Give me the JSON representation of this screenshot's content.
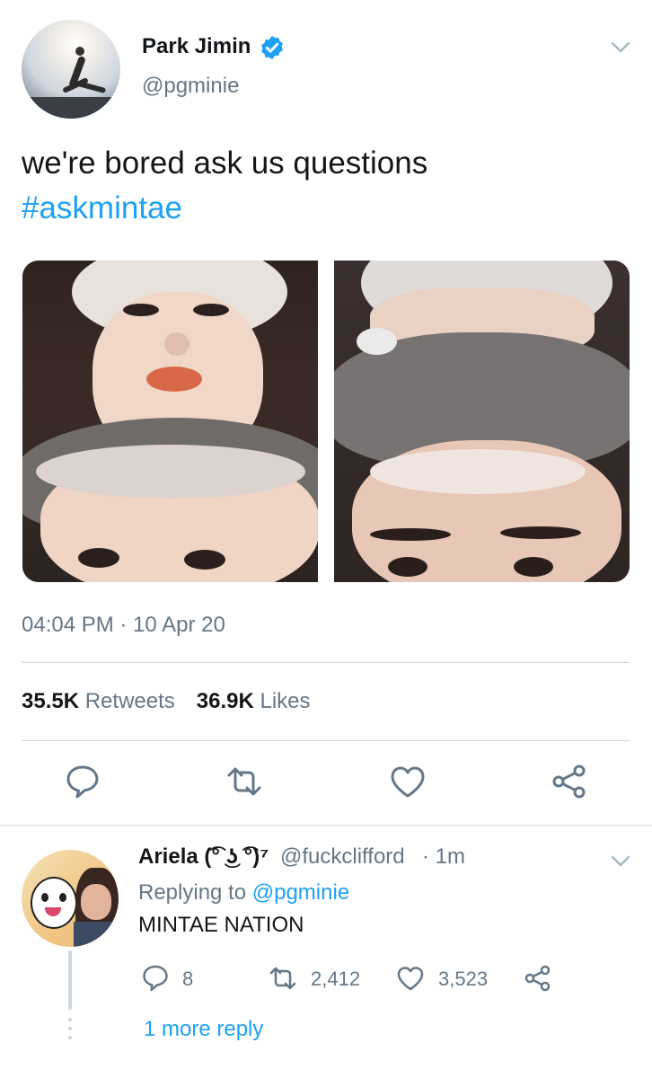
{
  "tweet": {
    "author_name": "Park Jimin",
    "author_handle": "@pgminie",
    "text": "we're bored ask us questions",
    "hashtag": "#askmintae",
    "timestamp": "04:04 PM · 10 Apr 20",
    "retweet_count": "35.5K",
    "retweets_label": "Retweets",
    "like_count": "36.9K",
    "likes_label": "Likes",
    "photos": [
      "selfie-photo-1",
      "selfie-photo-2"
    ]
  },
  "reply": {
    "author_name": "Ariela (͡° ͜ʖ ͡°)⁷",
    "author_handle": "@fuckclifford",
    "time": "· 1m",
    "replying_prefix": "Replying to",
    "replying_to": "@pgminie",
    "text": "MINTAE NATION",
    "reply_count": "8",
    "retweet_count": "2,412",
    "like_count": "3,523",
    "more_replies": "1 more reply"
  },
  "icons": {
    "verified": "verified-badge-icon",
    "menu": "chevron-down-icon",
    "reply": "reply-icon",
    "retweet": "retweet-icon",
    "like": "heart-icon",
    "share": "share-icon"
  },
  "colors": {
    "accent": "#1da1f2",
    "secondary_text": "#657786",
    "primary_text": "#14171a",
    "divider": "#ccd6dd"
  }
}
